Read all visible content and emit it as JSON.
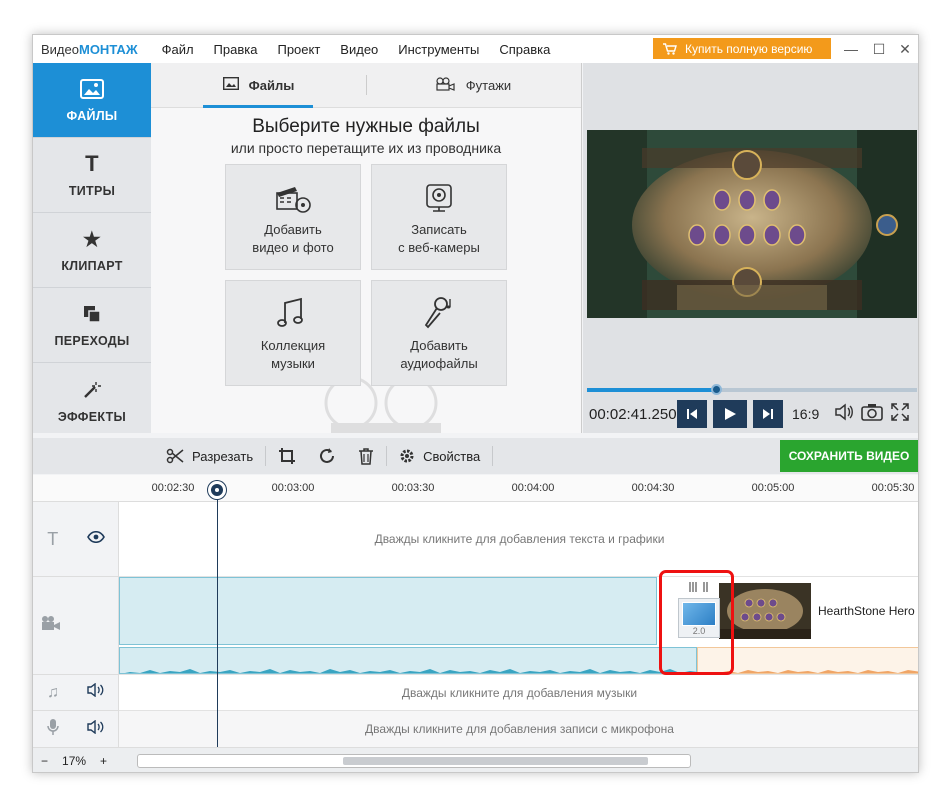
{
  "app": {
    "logo_prefix": "Видео",
    "logo_brand": "МОНТАЖ"
  },
  "menu": [
    "Файл",
    "Правка",
    "Проект",
    "Видео",
    "Инструменты",
    "Справка"
  ],
  "buy_button": "Купить полную версию",
  "sidebar": [
    {
      "label": "ФАЙЛЫ",
      "icon": "image-icon",
      "active": true
    },
    {
      "label": "ТИТРЫ",
      "icon": "text-icon",
      "active": false
    },
    {
      "label": "КЛИПАРТ",
      "icon": "star-icon",
      "active": false
    },
    {
      "label": "ПЕРЕХОДЫ",
      "icon": "transitions-icon",
      "active": false
    },
    {
      "label": "ЭФФЕКТЫ",
      "icon": "magic-wand-icon",
      "active": false
    }
  ],
  "files": {
    "tabs": [
      "Файлы",
      "Футажи"
    ],
    "heading": "Выберите нужные файлы",
    "subheading": "или просто перетащите их из проводника",
    "tiles": [
      {
        "line1": "Добавить",
        "line2": "видео и фото"
      },
      {
        "line1": "Записать",
        "line2": "с веб-камеры"
      },
      {
        "line1": "Коллекция",
        "line2": "музыки"
      },
      {
        "line1": "Добавить",
        "line2": "аудиофайлы"
      }
    ]
  },
  "preview": {
    "timecode": "00:02:41.250",
    "aspect": "16:9",
    "progress": 0.39
  },
  "toolbar": {
    "cut": "Разрезать",
    "properties": "Свойства",
    "save": "СОХРАНИТЬ ВИДЕО"
  },
  "ruler": [
    "00:02:30",
    "00:03:00",
    "00:03:30",
    "00:04:00",
    "00:04:30",
    "00:05:00",
    "00:05:30"
  ],
  "tracks": {
    "text_hint": "Дважды кликните для добавления текста и графики",
    "music_hint": "Дважды кликните для добавления музыки",
    "mic_hint": "Дважды кликните для добавления записи с микрофона",
    "clip_label": "HearthStone  Hero",
    "transition_duration": "2.0"
  },
  "zoom": {
    "minus": "−",
    "value": "17%",
    "plus": "+"
  },
  "colors": {
    "accent": "#1d8fd6",
    "buy": "#f39a1b",
    "save": "#2aa52f",
    "highlight": "#e11111"
  }
}
